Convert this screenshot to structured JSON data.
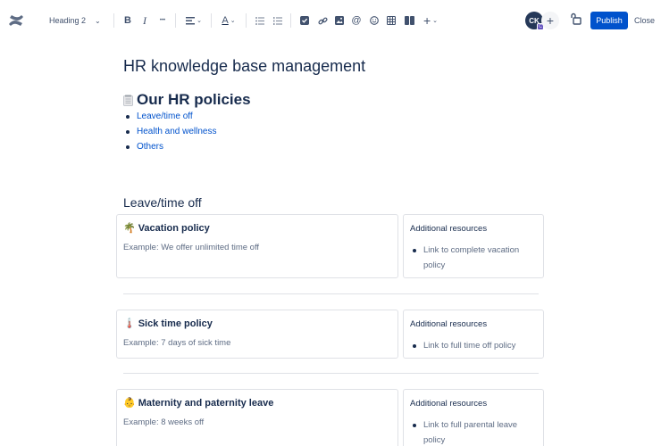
{
  "toolbar": {
    "text_style": "Heading 2",
    "bold": "B",
    "italic": "I",
    "more": "•••",
    "text_color": "A",
    "insert": "+",
    "avatar_initials": "CK",
    "avatar_badge": "C",
    "invite": "+",
    "publish_label": "Publish",
    "close_label": "Close",
    "accent_color": "#0052cc"
  },
  "page": {
    "title": "HR knowledge base management",
    "policies_heading": "Our HR policies",
    "policy_links": [
      "Leave/time off",
      "Health and wellness",
      "Others"
    ],
    "section_heading": "Leave/time off",
    "cards": [
      {
        "emoji": "🌴",
        "title": "Vacation policy",
        "body": "Example: We offer unlimited time off",
        "resources_title": "Additional resources",
        "resource_lines": [
          "Link to complete vacation",
          "policy"
        ]
      },
      {
        "emoji": "🌡️",
        "title": "Sick time policy",
        "body": "Example: 7 days of sick time",
        "resources_title": "Additional resources",
        "resource_lines": [
          "Link to full time off policy"
        ]
      },
      {
        "emoji": "👶",
        "title": "Maternity and paternity leave",
        "body": "Example: 8 weeks off",
        "resources_title": "Additional resources",
        "resource_lines": [
          "Link to full parental leave",
          "policy"
        ]
      }
    ]
  }
}
